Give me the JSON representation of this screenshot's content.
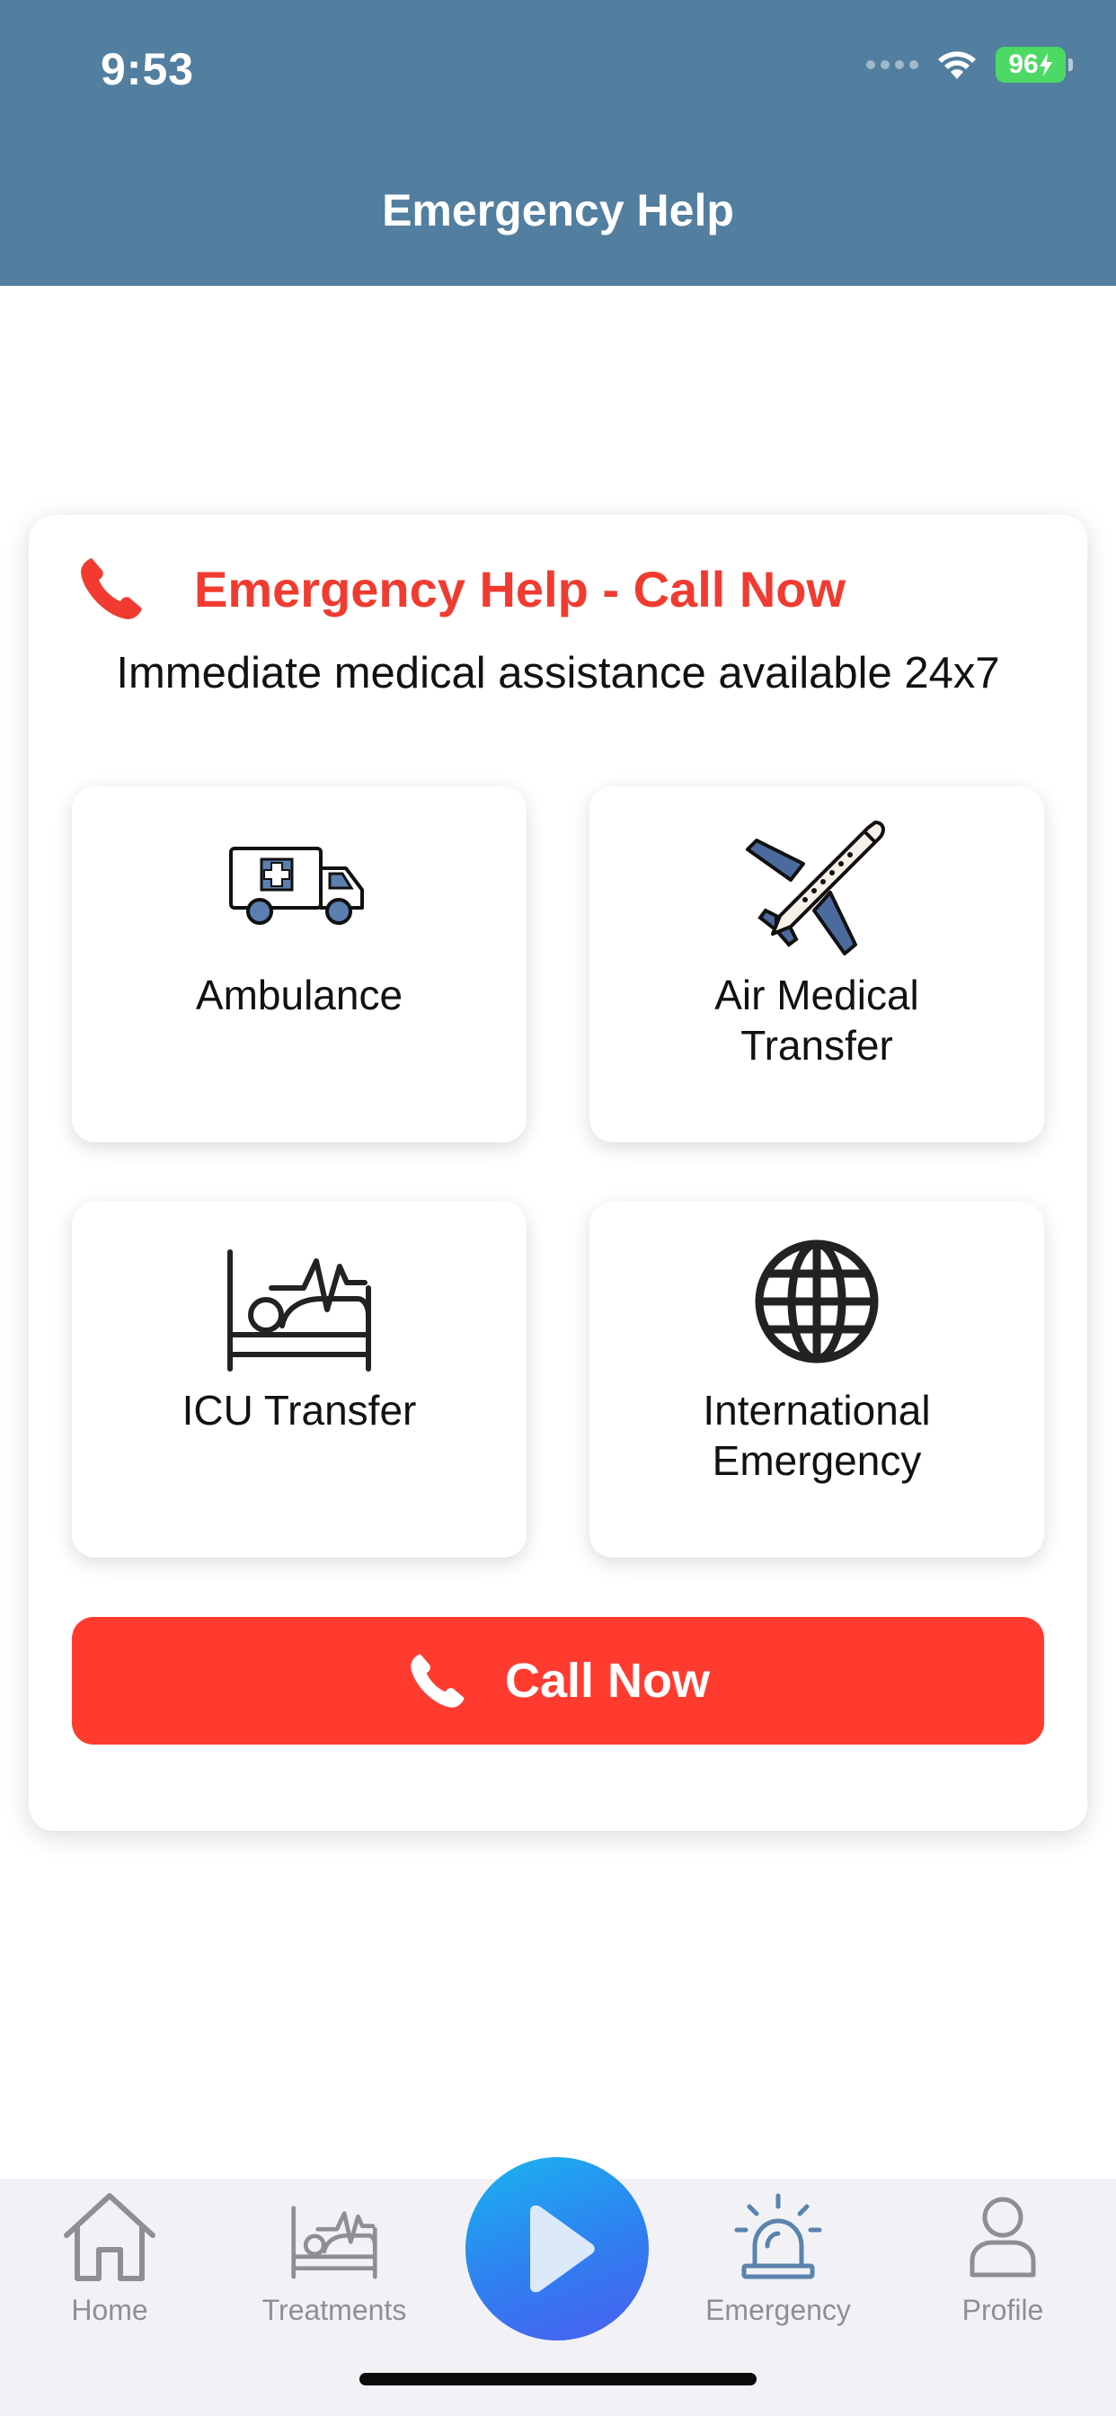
{
  "status_bar": {
    "time": "9:53",
    "battery": "96"
  },
  "header": {
    "title": "Emergency Help"
  },
  "card": {
    "title": "Emergency Help - Call Now",
    "subtitle": "Immediate medical assistance available 24x7",
    "services": [
      {
        "label": "Ambulance",
        "icon": "ambulance-icon"
      },
      {
        "label": "Air Medical Transfer",
        "icon": "airplane-icon"
      },
      {
        "label": "ICU Transfer",
        "icon": "icu-bed-icon"
      },
      {
        "label": "International Emergency",
        "icon": "globe-icon"
      }
    ],
    "call_button_label": "Call Now"
  },
  "tabbar": {
    "items": [
      {
        "label": "Home",
        "icon": "home-icon"
      },
      {
        "label": "Treatments",
        "icon": "treatments-bed-icon"
      },
      {
        "label": "Emergency",
        "icon": "siren-icon"
      },
      {
        "label": "Profile",
        "icon": "profile-icon"
      }
    ],
    "active": "Emergency",
    "center_button_icon": "play-icon"
  },
  "colors": {
    "header_bg": "#527e9f",
    "accent_red": "#ff3b30",
    "title_red": "#f13b30",
    "active_tab": "#5a83ad",
    "inactive_tab": "#8e8e93"
  }
}
